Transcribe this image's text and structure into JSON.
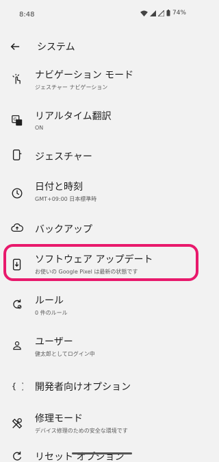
{
  "status": {
    "time": "8:48",
    "battery": "74%"
  },
  "app_bar": {
    "title": "システム"
  },
  "items": [
    {
      "title": "ナビゲーション モード",
      "subtitle": "ジェスチャー ナビゲーション",
      "icon": "touch-gesture-icon"
    },
    {
      "title": "リアルタイム翻訳",
      "subtitle": "ON",
      "icon": "translate-icon"
    },
    {
      "title": "ジェスチャー",
      "subtitle": "",
      "icon": "phone-gesture-icon"
    },
    {
      "title": "日付と時刻",
      "subtitle": "GMT+09:00 日本標準時",
      "icon": "clock-icon"
    },
    {
      "title": "バックアップ",
      "subtitle": "",
      "icon": "cloud-upload-icon"
    },
    {
      "title": "ソフトウェア アップデート",
      "subtitle": "お使いの Google Pixel は最新の状態です",
      "icon": "system-update-icon"
    },
    {
      "title": "ルール",
      "subtitle": "0 件のルール",
      "icon": "rules-icon"
    },
    {
      "title": "ユーザー",
      "subtitle": "健太郎としてログイン中",
      "icon": "person-icon"
    },
    {
      "title": "開発者向けオプション",
      "subtitle": "",
      "icon": "code-braces-icon"
    },
    {
      "title": "修理モード",
      "subtitle": "デバイス修理のための安全な環境です",
      "icon": "repair-icon"
    },
    {
      "title": "リセット オプション",
      "subtitle": "",
      "icon": "reset-icon"
    }
  ],
  "highlight_color": "#e8196c"
}
